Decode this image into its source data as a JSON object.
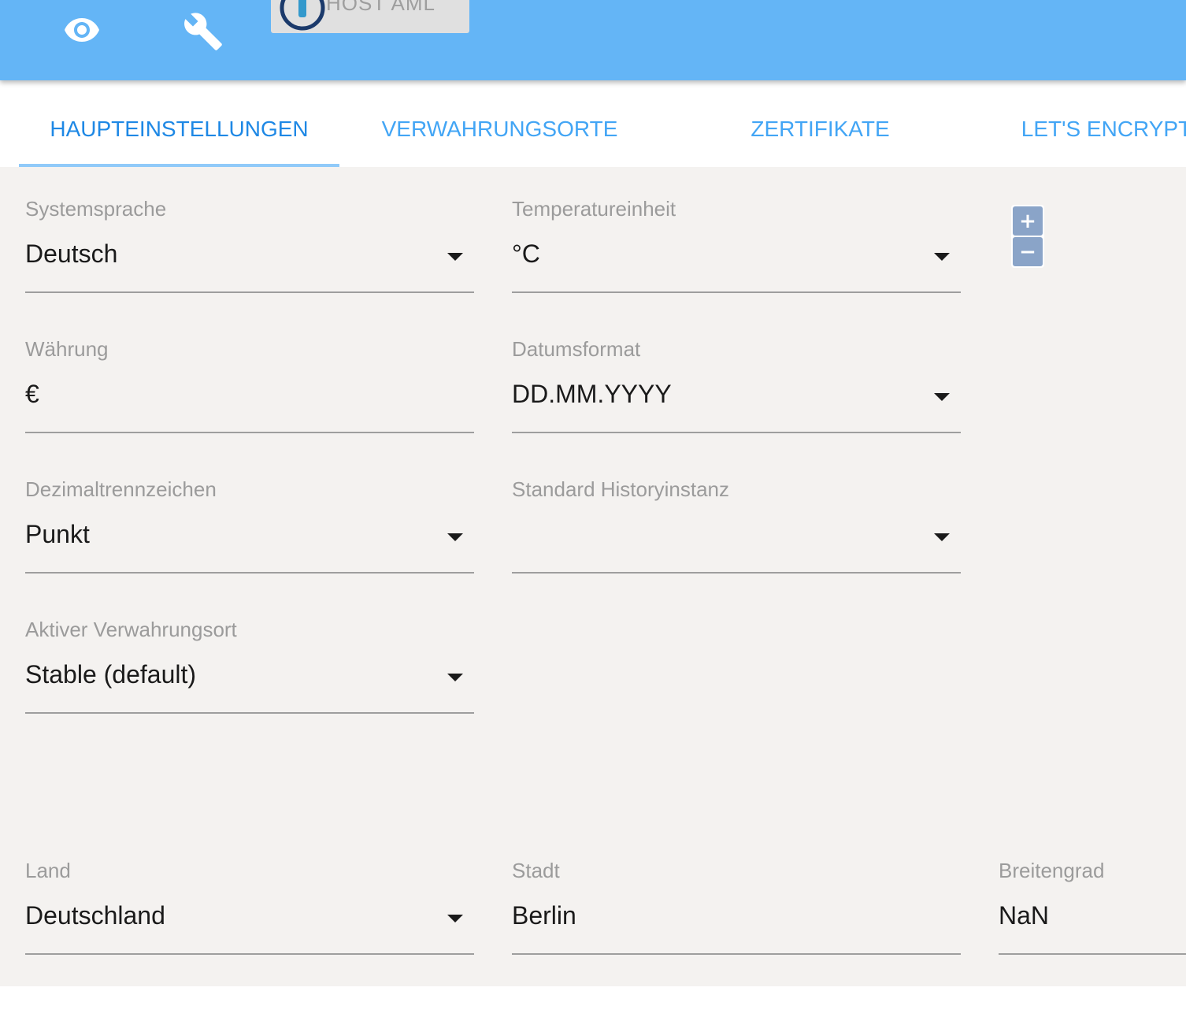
{
  "toolbar": {
    "view_icon": "eye-icon",
    "settings_icon": "wrench-icon",
    "host_chip_label": "HOST AML",
    "host_logo_icon": "iobroker-logo-icon"
  },
  "tabs": [
    {
      "label": "HAUPTEINSTELLUNGEN",
      "active": true
    },
    {
      "label": "VERWAHRUNGSORTE",
      "active": false
    },
    {
      "label": "ZERTIFIKATE",
      "active": false
    },
    {
      "label": "LET'S ENCRYPT",
      "active": false
    }
  ],
  "form": {
    "system_language": {
      "label": "Systemsprache",
      "value": "Deutsch"
    },
    "temperature_unit": {
      "label": "Temperatureinheit",
      "value": "°C"
    },
    "currency": {
      "label": "Währung",
      "value": "€"
    },
    "date_format": {
      "label": "Datumsformat",
      "value": "DD.MM.YYYY"
    },
    "decimal_separator": {
      "label": "Dezimaltrennzeichen",
      "value": "Punkt"
    },
    "default_history": {
      "label": "Standard Historyinstanz",
      "value": ""
    },
    "active_repository": {
      "label": "Aktiver Verwahrungsort",
      "value": "Stable (default)"
    },
    "country": {
      "label": "Land",
      "value": "Deutschland"
    },
    "city": {
      "label": "Stadt",
      "value": "Berlin"
    },
    "latitude": {
      "label": "Breitengrad",
      "value": "NaN"
    }
  },
  "map_zoom": {
    "zoom_in": "+",
    "zoom_out": "−"
  },
  "colors": {
    "header": "#64b5f6",
    "tab_text": "#42a5f5",
    "tab_indicator": "#90caf9",
    "content_bg": "#f4f2f0",
    "zoom_button": "#8aa4c8"
  }
}
